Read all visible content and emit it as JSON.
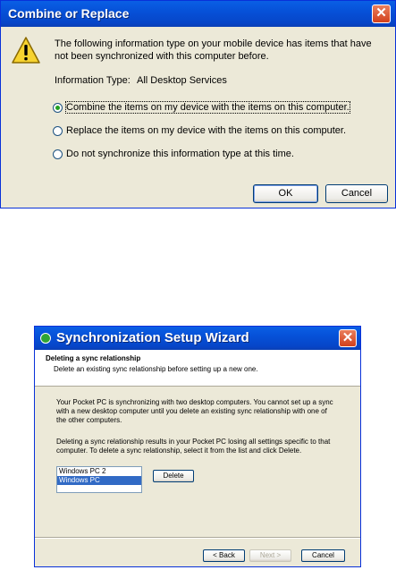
{
  "dialog1": {
    "title": "Combine or Replace",
    "message": "The following information type on your mobile device has items that have not been synchronized with this computer before.",
    "info_label": "Information Type:",
    "info_value": "All Desktop Services",
    "options": [
      {
        "text": "Combine the items on my device with the items on this computer.",
        "checked": true
      },
      {
        "text": "Replace the items on my device with the items on this computer.",
        "checked": false
      },
      {
        "text": "Do not synchronize this information type at this time.",
        "checked": false
      }
    ],
    "ok_label": "OK",
    "cancel_label": "Cancel",
    "icons": {
      "warning": "warning-icon",
      "close": "close-icon"
    }
  },
  "dialog2": {
    "title": "Synchronization Setup Wizard",
    "header_title": "Deleting a sync relationship",
    "header_subtitle": "Delete an existing sync relationship before setting up a new one.",
    "paragraph1": "Your Pocket PC is synchronizing with two desktop computers.  You cannot set up a sync with a new desktop computer until you delete an existing sync relationship with one of the other computers.",
    "paragraph2": "Deleting a sync relationship results in your Pocket PC losing all settings specific to that computer.  To delete a sync relationship, select it from the list and click Delete.",
    "list_items": [
      "Windows PC 2",
      "Windows PC"
    ],
    "selected_item": "Windows PC",
    "delete_label": "Delete",
    "back_label": "< Back",
    "next_label": "Next >",
    "cancel_label": "Cancel",
    "colors": {
      "titlebar": "#0651d8",
      "selection": "#316ac5",
      "dialog_bg": "#ece9d8"
    }
  }
}
